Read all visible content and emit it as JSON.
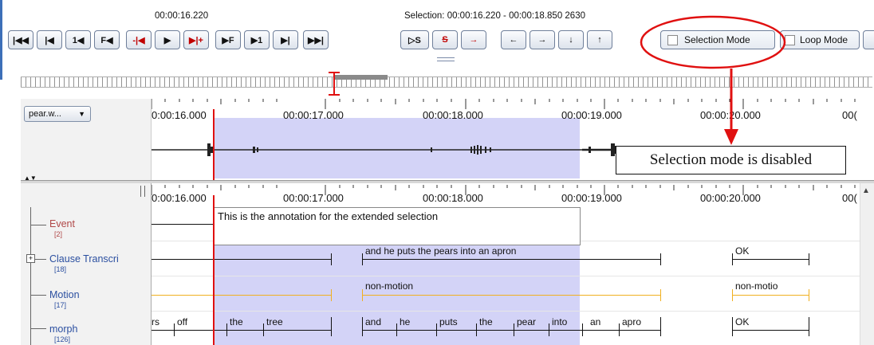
{
  "toolbar": {
    "current_time": "00:00:16.220",
    "selection_info": "Selection: 00:00:16.220 - 00:00:18.850  2630",
    "selection_mode_label": "Selection Mode",
    "loop_mode_label": "Loop Mode",
    "nav_buttons": [
      "|◀◀",
      "|◀",
      "1◀",
      "F◀",
      "-|◀",
      "▶",
      "▶|+",
      "▶F",
      "▶1",
      "▶|",
      "▶▶|"
    ],
    "play_sel_label": "▷S",
    "clear_sel_label": "S",
    "arrow_buttons": [
      "→",
      "←",
      "→",
      "↓",
      "↑"
    ]
  },
  "waveform_panel": {
    "file_selector": "pear.w...",
    "ruler_ticks": [
      "0:00:16.000",
      "00:00:17.000",
      "00:00:18.000",
      "00:00:19.000",
      "00:00:20.000",
      "00("
    ]
  },
  "annotation_panel": {
    "ruler_ticks": [
      "0:00:16.000",
      "00:00:17.000",
      "00:00:18.000",
      "00:00:19.000",
      "00:00:20.000",
      "00("
    ],
    "editor_text": "This is the annotation for the extended selection",
    "tiers": [
      {
        "name": "Event",
        "count": "[2]"
      },
      {
        "name": "Clause Transcri",
        "count": "[18]"
      },
      {
        "name": "Motion",
        "count": "[17]"
      },
      {
        "name": "morph",
        "count": "[126]"
      }
    ],
    "clause_annotations": [
      "and he puts the pears into an apron",
      "OK"
    ],
    "motion_annotations": [
      "non-motion",
      "non-motio"
    ],
    "morph_annotations": [
      "rs",
      "off",
      "the",
      "tree",
      "and",
      "he",
      "puts",
      "the",
      "pear",
      "into",
      "an",
      "apro",
      "OK"
    ]
  },
  "callout": {
    "text": "Selection mode is disabled"
  },
  "colors": {
    "selection": "#d3d3f7",
    "cursor": "#e01010",
    "callout": "#e01010",
    "motion_line": "#f0b020",
    "tier_label": "#2b4fa0",
    "event_label": "#b04848"
  }
}
